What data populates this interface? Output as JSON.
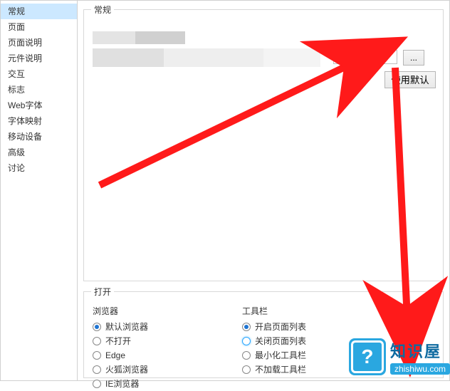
{
  "sidebar": {
    "items": [
      {
        "label": "常规",
        "selected": true
      },
      {
        "label": "页面"
      },
      {
        "label": "页面说明"
      },
      {
        "label": "元件说明"
      },
      {
        "label": "交互"
      },
      {
        "label": "标志"
      },
      {
        "label": "Web字体"
      },
      {
        "label": "字体映射"
      },
      {
        "label": "移动设备"
      },
      {
        "label": "高级"
      },
      {
        "label": "讨论"
      }
    ]
  },
  "general": {
    "legend": "常规",
    "browse_label": "...",
    "use_default_label": "使用默认"
  },
  "open": {
    "legend": "打开",
    "browser": {
      "title": "浏览器",
      "options": [
        {
          "label": "默认浏览器",
          "checked": true
        },
        {
          "label": "不打开"
        },
        {
          "label": "Edge"
        },
        {
          "label": "火狐浏览器"
        },
        {
          "label": "IE浏览器"
        }
      ]
    },
    "toolbar": {
      "title": "工具栏",
      "options": [
        {
          "label": "开启页面列表",
          "checked": true
        },
        {
          "label": "关闭页面列表",
          "hover": true
        },
        {
          "label": "最小化工具栏"
        },
        {
          "label": "不加载工具栏"
        }
      ]
    }
  },
  "watermark": {
    "icon_text": "?",
    "brand_cn": "知识屋",
    "brand_en": "zhishiwu.com"
  }
}
